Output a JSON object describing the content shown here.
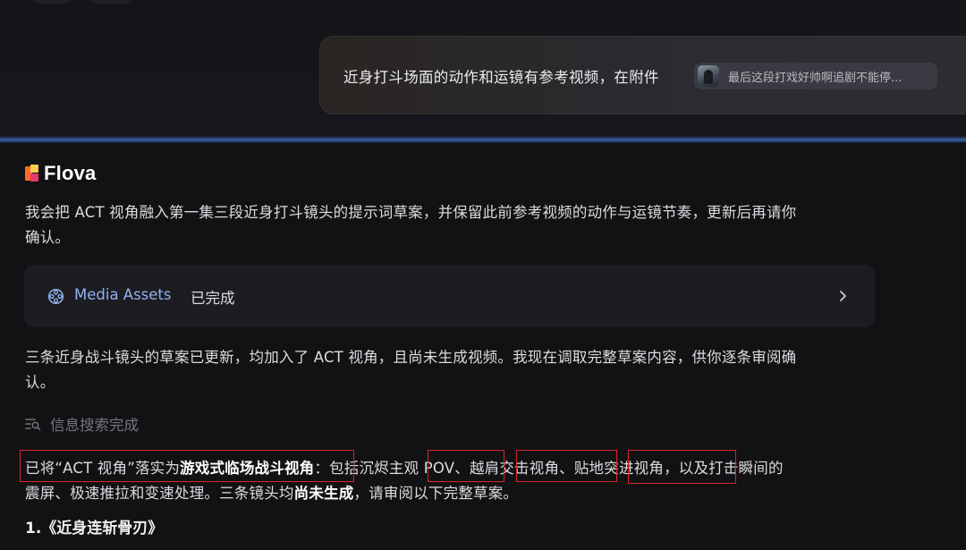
{
  "user_message": {
    "text": "近身打斗场面的动作和运镜有参考视频，在附件",
    "attachment_name": "最后这段打戏好帅啊追剧不能停..."
  },
  "brand": {
    "name": "Flova"
  },
  "assistant": {
    "intro_line1": "我会把 ACT 视角融入第一集三段近身打斗镜头的提示词草案，并保留此前参考视频的动作与运镜节奏，更新后再请你",
    "intro_line2": "确认。",
    "media_card": {
      "label": "Media Assets",
      "status": "已完成"
    },
    "update_line1": "三条近身战斗镜头的草案已更新，均加入了 ACT 视角，且尚未生成视频。我现在调取完整草案内容，供你逐条审阅确",
    "update_line2": "认。",
    "search_status": "信息搜索完成",
    "summary": {
      "part1": "已将“ACT 视角”落实为",
      "part2_bold": "游戏式临场战斗视角",
      "part3": "：包括沉烬",
      "part4": "主观 POV",
      "part5": "、",
      "part6": "越肩交击视角",
      "part7": "、",
      "part8": "贴地突进视角",
      "part9": "，以及打击瞬间的",
      "line2_part1": "震屏、极速推拉和变速处理。三条镜头均",
      "line2_bold": "尚未生成",
      "line2_part2": "，请审阅以下完整草案。"
    },
    "section_heading": "1.《近身连斩骨刃》"
  },
  "colors": {
    "background": "#121214",
    "accent_link": "#8fb2f0",
    "highlight_box": "#d8262a",
    "divider_glow": "#3d62ad"
  },
  "icons": {
    "media": "film-reel-icon",
    "chevron": "chevron-right-icon",
    "search": "search-list-icon"
  }
}
